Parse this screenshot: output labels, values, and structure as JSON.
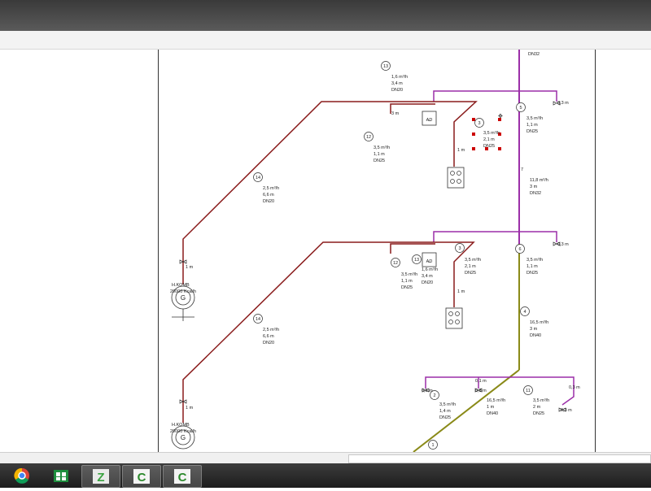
{
  "app": {
    "title": ""
  },
  "taskbar": {
    "items": [
      {
        "name": "chrome",
        "icon": "chrome-icon"
      },
      {
        "name": "store",
        "icon": "store-icon"
      },
      {
        "name": "app-active",
        "icon": "app-z-icon"
      },
      {
        "name": "camtasia-recorder",
        "icon": "camtasia-icon"
      },
      {
        "name": "camtasia-editor",
        "icon": "camtasia-icon"
      }
    ]
  },
  "drawing": {
    "colors": {
      "gas_main": "#8a1c1c",
      "riser": "#9b2fa8",
      "feeder": "#8a8a18"
    },
    "labels": {
      "dn32_top": "DN32",
      "n13": "13",
      "t13": [
        "1,6 m³/h",
        "3,4 m",
        "DN20"
      ],
      "len_13": "3 m",
      "n12a": "12",
      "t12a": [
        "3,5 m³/h",
        "1,1 m",
        "DN25"
      ],
      "n3a": "3",
      "t3a": [
        "3,5 m³/h",
        "2,1 m",
        "DN25"
      ],
      "n5": "5",
      "t5": [
        "3,5 m³/h",
        "1,1 m",
        "DN25"
      ],
      "len_5": "0,3 m",
      "n7": "7",
      "t7": [
        "11,8 m³/h",
        "3 m",
        "DN32"
      ],
      "n14a": "14",
      "t14a": [
        "2,5 m³/h",
        "6,6 m",
        "DN20"
      ],
      "len_1a": "1 m",
      "len_b1": "1 m",
      "len_c1": "1 m",
      "boiler_label": "H.KOMB",
      "boiler_sub": "20000 Kcal/h",
      "n12b": "12",
      "t12b": [
        "3,5 m³/h",
        "1,1 m",
        "DN25"
      ],
      "n13b": "13",
      "t13b": [
        "1,6 m³/h",
        "3,4 m",
        "DN20"
      ],
      "n3b": "3",
      "t3b": [
        "3,5 m³/h",
        "2,1 m",
        "DN25"
      ],
      "n6": "6",
      "t6": [
        "3,5 m³/h",
        "1,1 m",
        "DN25"
      ],
      "len_6": "0,3 m",
      "n4": "4",
      "t4": [
        "16,5 m³/h",
        "3 m",
        "DN40"
      ],
      "n14b": "14",
      "t14b": [
        "2,5 m³/h",
        "6,6 m",
        "DN20"
      ],
      "n2": "2",
      "t2": [
        "3,5 m³/h",
        "1,4 m",
        "DN25"
      ],
      "t10": [
        "16,5 m³/h",
        "1 m",
        "DN40"
      ],
      "n11": "11",
      "t11": [
        "3,5 m³/h",
        "2 m",
        "DN25"
      ],
      "len_01": "0,1 m",
      "len_03a": "0,3 m",
      "len_03b": "0,3 m",
      "len_03c": "0,3 m",
      "n1": "1",
      "generator": "G"
    }
  }
}
